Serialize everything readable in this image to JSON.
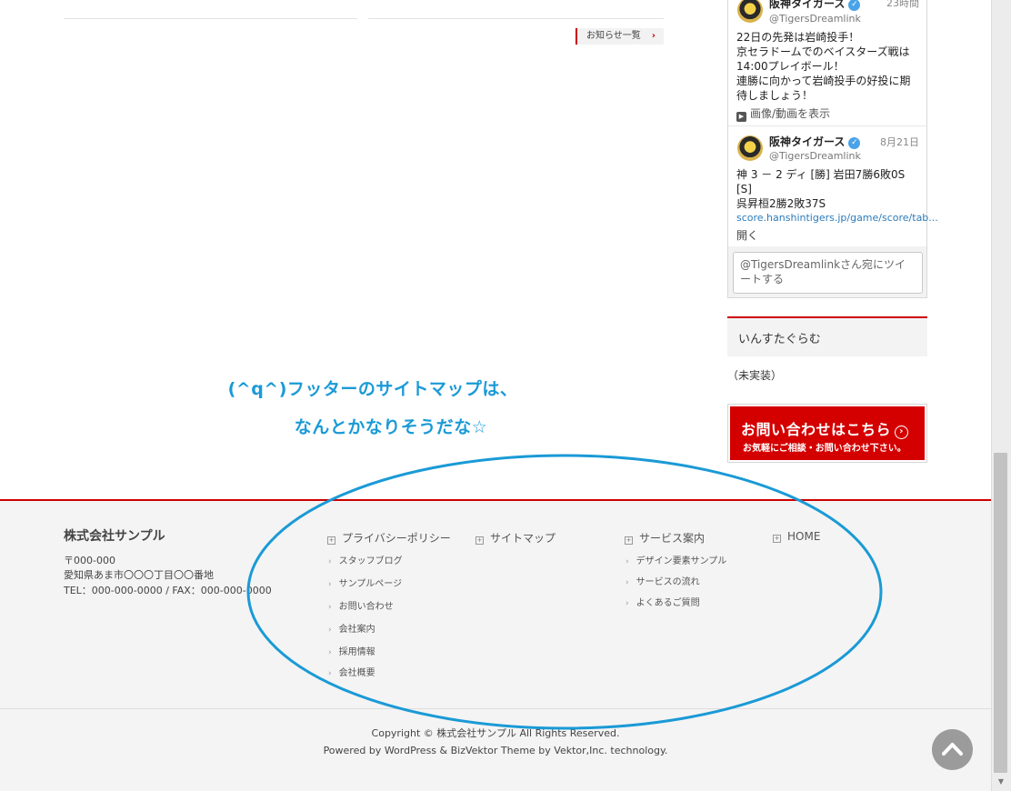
{
  "main": {
    "news_link_label": "お知らせ一覧",
    "news_link_arrow": "›"
  },
  "annotation": {
    "line1": "(^q^)フッターのサイトマップは、",
    "line2": "なんとかなりそうだな☆",
    "color": "#1a9ad6"
  },
  "twitter": {
    "tweets": [
      {
        "name": "阪神タイガース",
        "handle": "@TigersDreamlink",
        "time": "23時間",
        "lines": [
          "22日の先発は岩崎投手！",
          "京セラドームでのベイスターズ戦は",
          "14:00プレイボール！",
          "連勝に向かって岩崎投手の好投に期",
          "待しましょう！"
        ],
        "media_label": "画像/動画を表示"
      },
      {
        "name": "阪神タイガース",
        "handle": "@TigersDreamlink",
        "time": "8月21日",
        "lines": [
          "神 3 － 2 ディ [勝] 岩田7勝6敗0S [S]",
          "呉昇桓2勝2敗37S"
        ],
        "link": "score.hanshintigers.jp/game/score/tab...",
        "open_label": "開く"
      }
    ],
    "compose_placeholder": "@TigersDreamlinkさん宛にツイートする"
  },
  "sidebar": {
    "widget_title": "いんすたぐらむ",
    "widget_note": "（未実装）",
    "contact_main": "お問い合わせはこちら",
    "contact_sub": "お気軽にご相談・お問い合わせ下さい。",
    "accent_color": "#d40000"
  },
  "footer": {
    "company": "株式会社サンプル",
    "postal": "〒000-000",
    "address": "愛知県あま市〇〇〇丁目〇〇番地",
    "tel_fax": "TEL：000-000-0000 / FAX：000-000-0000",
    "categories": [
      {
        "label": "プライバシーポリシー",
        "items": [
          "スタッフブログ",
          "サンプルページ",
          "お問い合わせ",
          "会社案内",
          "採用情報",
          "会社概要"
        ]
      },
      {
        "label": "サイトマップ",
        "items": []
      },
      {
        "label": "サービス案内",
        "items": [
          "デザイン要素サンプル",
          "サービスの流れ",
          "よくあるご質問"
        ]
      },
      {
        "label": "HOME",
        "items": []
      }
    ],
    "copyright": "Copyright © 株式会社サンプル All Rights Reserved.",
    "powered": "Powered by WordPress & BizVektor Theme by Vektor,Inc. technology."
  }
}
